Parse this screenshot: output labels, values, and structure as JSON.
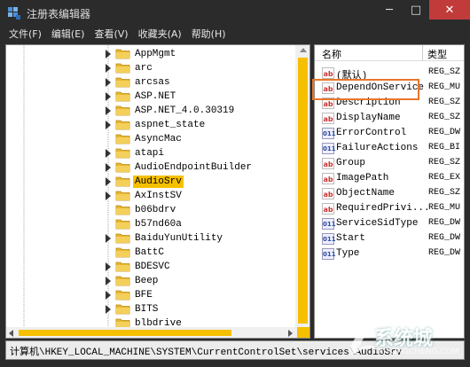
{
  "window": {
    "title": "注册表编辑器",
    "minimize": "─",
    "maximize": "□",
    "close": "✕"
  },
  "menu": [
    {
      "label": "文件(F)"
    },
    {
      "label": "编辑(E)"
    },
    {
      "label": "查看(V)"
    },
    {
      "label": "收藏夹(A)"
    },
    {
      "label": "帮助(H)"
    }
  ],
  "tree": {
    "selected": "AudioSrv",
    "items": [
      {
        "label": "AppMgmt",
        "expandable": true
      },
      {
        "label": "arc",
        "expandable": true
      },
      {
        "label": "arcsas",
        "expandable": true
      },
      {
        "label": "ASP.NET",
        "expandable": true
      },
      {
        "label": "ASP.NET_4.0.30319",
        "expandable": true
      },
      {
        "label": "aspnet_state",
        "expandable": true
      },
      {
        "label": "AsyncMac",
        "expandable": false
      },
      {
        "label": "atapi",
        "expandable": true
      },
      {
        "label": "AudioEndpointBuilder",
        "expandable": true
      },
      {
        "label": "AudioSrv",
        "expandable": true
      },
      {
        "label": "AxInstSV",
        "expandable": true
      },
      {
        "label": "b06bdrv",
        "expandable": false
      },
      {
        "label": "b57nd60a",
        "expandable": false
      },
      {
        "label": "BaiduYunUtility",
        "expandable": true
      },
      {
        "label": "BattC",
        "expandable": false
      },
      {
        "label": "BDESVC",
        "expandable": true
      },
      {
        "label": "Beep",
        "expandable": true
      },
      {
        "label": "BFE",
        "expandable": true
      },
      {
        "label": "BITS",
        "expandable": true
      },
      {
        "label": "blbdrive",
        "expandable": false
      }
    ]
  },
  "values": {
    "header_name": "名称",
    "header_type": "类型",
    "highlighted": "DependOnService",
    "rows": [
      {
        "name": "(默认)",
        "type": "REG_SZ",
        "icon": "string"
      },
      {
        "name": "DependOnService",
        "type": "REG_MU",
        "icon": "string"
      },
      {
        "name": "Description",
        "type": "REG_SZ",
        "icon": "string"
      },
      {
        "name": "DisplayName",
        "type": "REG_SZ",
        "icon": "string"
      },
      {
        "name": "ErrorControl",
        "type": "REG_DW",
        "icon": "binary"
      },
      {
        "name": "FailureActions",
        "type": "REG_BI",
        "icon": "binary"
      },
      {
        "name": "Group",
        "type": "REG_SZ",
        "icon": "string"
      },
      {
        "name": "ImagePath",
        "type": "REG_EX",
        "icon": "string"
      },
      {
        "name": "ObjectName",
        "type": "REG_SZ",
        "icon": "string"
      },
      {
        "name": "RequiredPrivi...",
        "type": "REG_MU",
        "icon": "string"
      },
      {
        "name": "ServiceSidType",
        "type": "REG_DW",
        "icon": "binary"
      },
      {
        "name": "Start",
        "type": "REG_DW",
        "icon": "binary"
      },
      {
        "name": "Type",
        "type": "REG_DW",
        "icon": "binary"
      }
    ]
  },
  "status": {
    "path": "计算机\\HKEY_LOCAL_MACHINE\\SYSTEM\\CurrentControlSet\\services\\AudioSrv"
  },
  "watermark": {
    "text": "系统城",
    "sub": "XITONGCHENG.COM"
  },
  "colors": {
    "selection": "#f6c000",
    "highlight_border": "#e8762a",
    "close": "#c23b3b"
  }
}
